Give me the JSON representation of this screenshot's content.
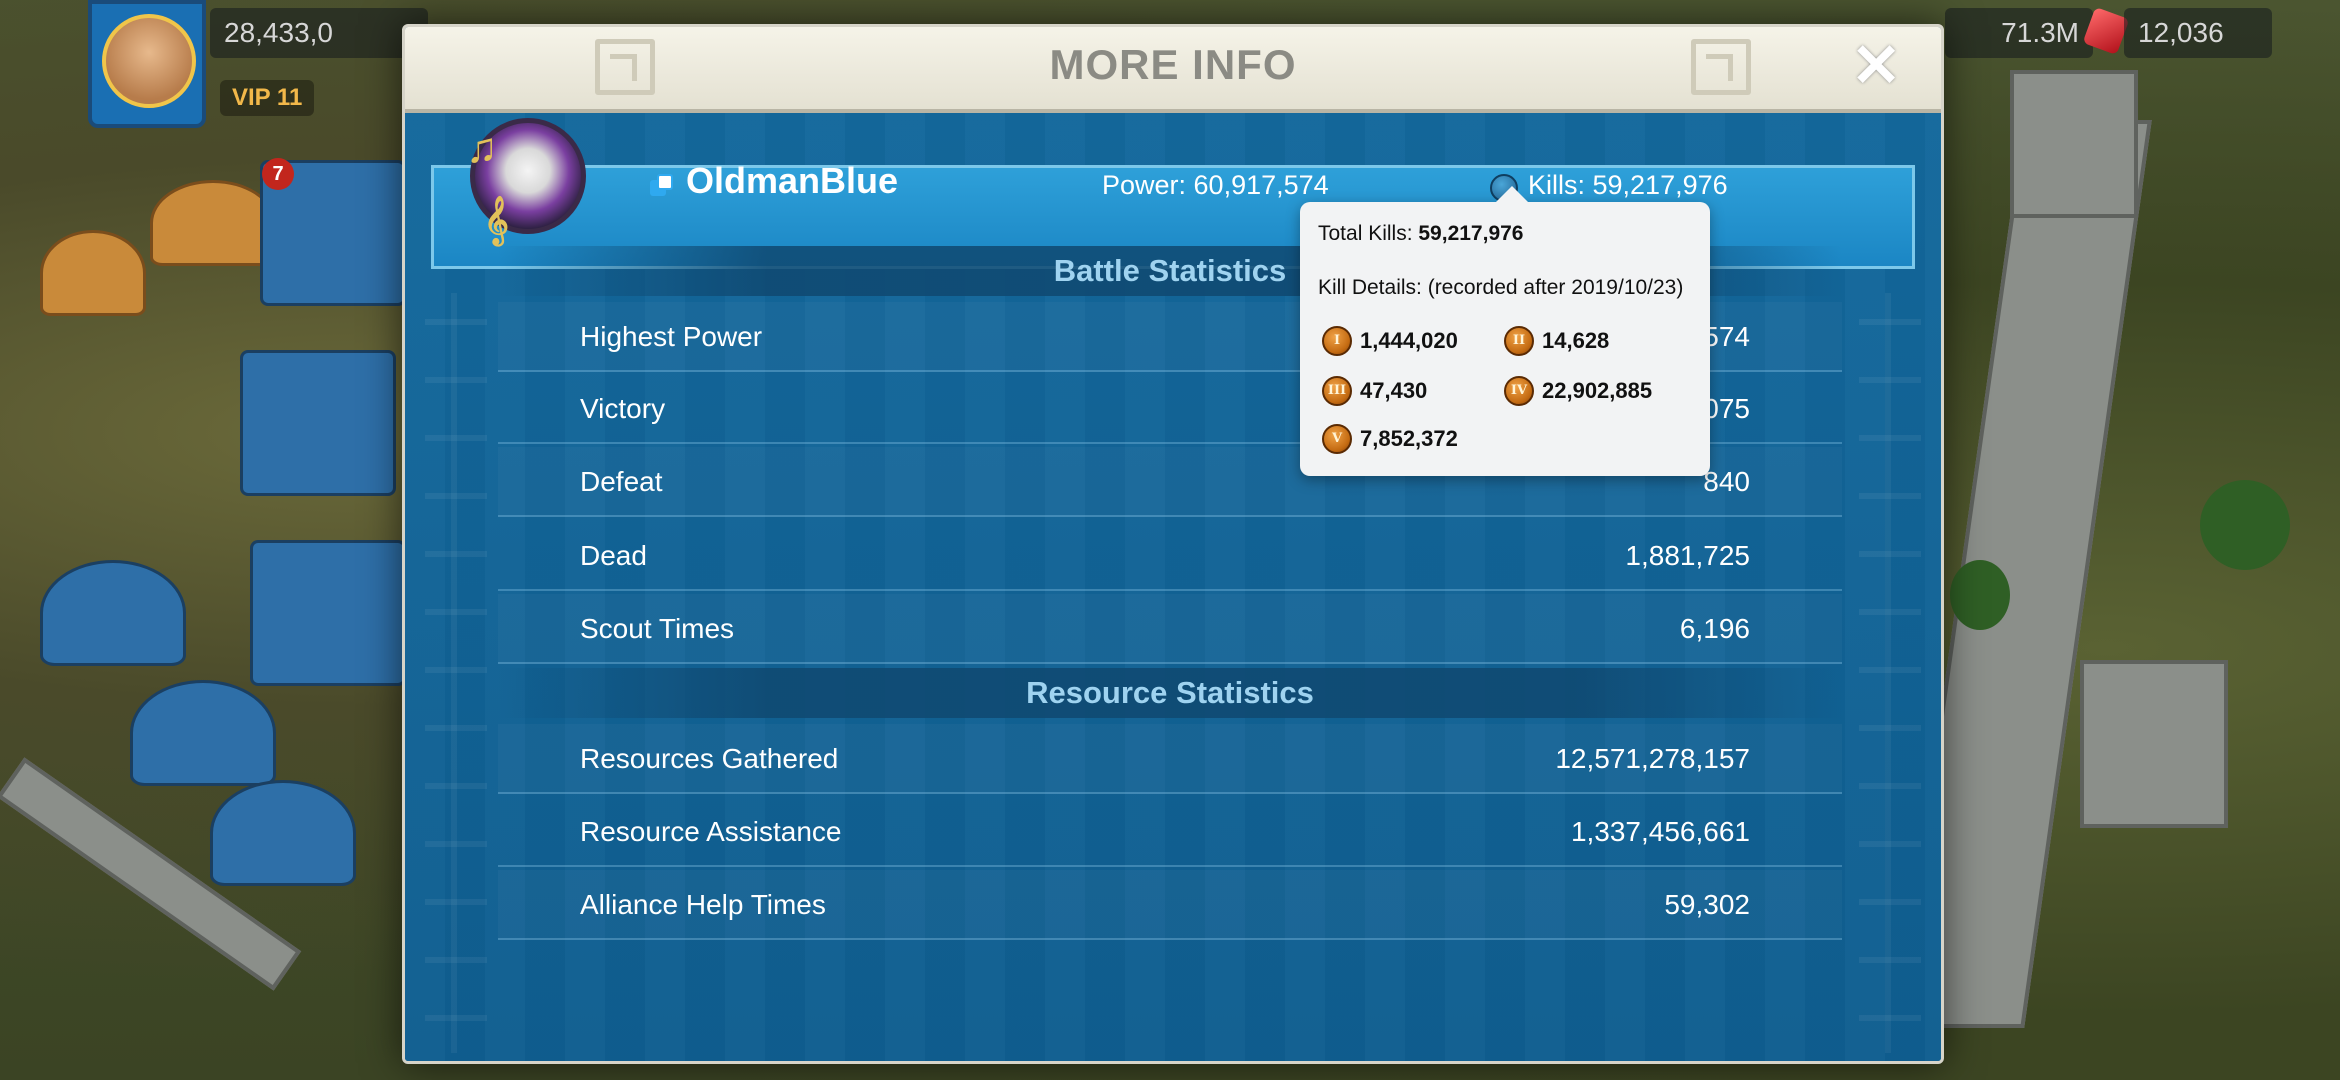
{
  "hud": {
    "resource_left": "28,433,0",
    "vip": "VIP 11",
    "notification_count": "7",
    "resource_right": "71.3M",
    "gems": "12,036"
  },
  "modal": {
    "title": "MORE INFO",
    "close_label": "✕"
  },
  "player": {
    "name": "OldmanBlue",
    "power": "Power: 60,917,574",
    "kills": "Kills: 59,217,976"
  },
  "battle": {
    "header": "Battle Statistics",
    "rows": [
      {
        "label": "Highest Power",
        "value": "60,917,574"
      },
      {
        "label": "Victory",
        "value": "62,075"
      },
      {
        "label": "Defeat",
        "value": "840"
      },
      {
        "label": "Dead",
        "value": "1,881,725"
      },
      {
        "label": "Scout Times",
        "value": "6,196"
      }
    ]
  },
  "resource": {
    "header": "Resource Statistics",
    "rows": [
      {
        "label": "Resources Gathered",
        "value": "12,571,278,157"
      },
      {
        "label": "Resource Assistance",
        "value": "1,337,456,661"
      },
      {
        "label": "Alliance Help Times",
        "value": "59,302"
      }
    ]
  },
  "tooltip": {
    "total_label": "Total Kills: ",
    "total_value": "59,217,976",
    "details": "Kill Details: (recorded after 2019/10/23)",
    "tiers": [
      {
        "roman": "I",
        "value": "1,444,020"
      },
      {
        "roman": "II",
        "value": "14,628"
      },
      {
        "roman": "III",
        "value": "47,430"
      },
      {
        "roman": "IV",
        "value": "22,902,885"
      },
      {
        "roman": "V",
        "value": "7,852,372"
      }
    ]
  },
  "colors": {
    "panel_blue": "#0f5a8c",
    "player_bar": "#2ea0d9",
    "section_header_text": "#9fd3f0",
    "medal_bronze": "#c46b12"
  }
}
